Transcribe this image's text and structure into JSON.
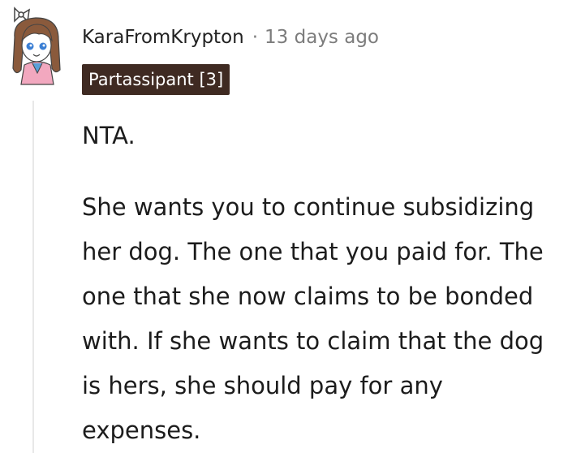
{
  "comment": {
    "author": "KaraFromKrypton",
    "separator": "·",
    "time_ago": "13 days ago",
    "flair": "Partassipant [3]",
    "paragraphs": [
      "NTA.",
      "She wants you to continue subsidizing her dog. The one that you paid for. The one that she now claims to be bonded with. If she wants to claim that the dog is hers, she should pay for any expenses."
    ]
  },
  "colors": {
    "flair_background": "#3f2a22",
    "flair_text": "#ffffff",
    "meta_text": "#7c7c7c",
    "body_text": "#1c1c1c",
    "thread_line": "#e8e8e8"
  },
  "icons": {
    "avatar": "user-avatar-icon"
  }
}
